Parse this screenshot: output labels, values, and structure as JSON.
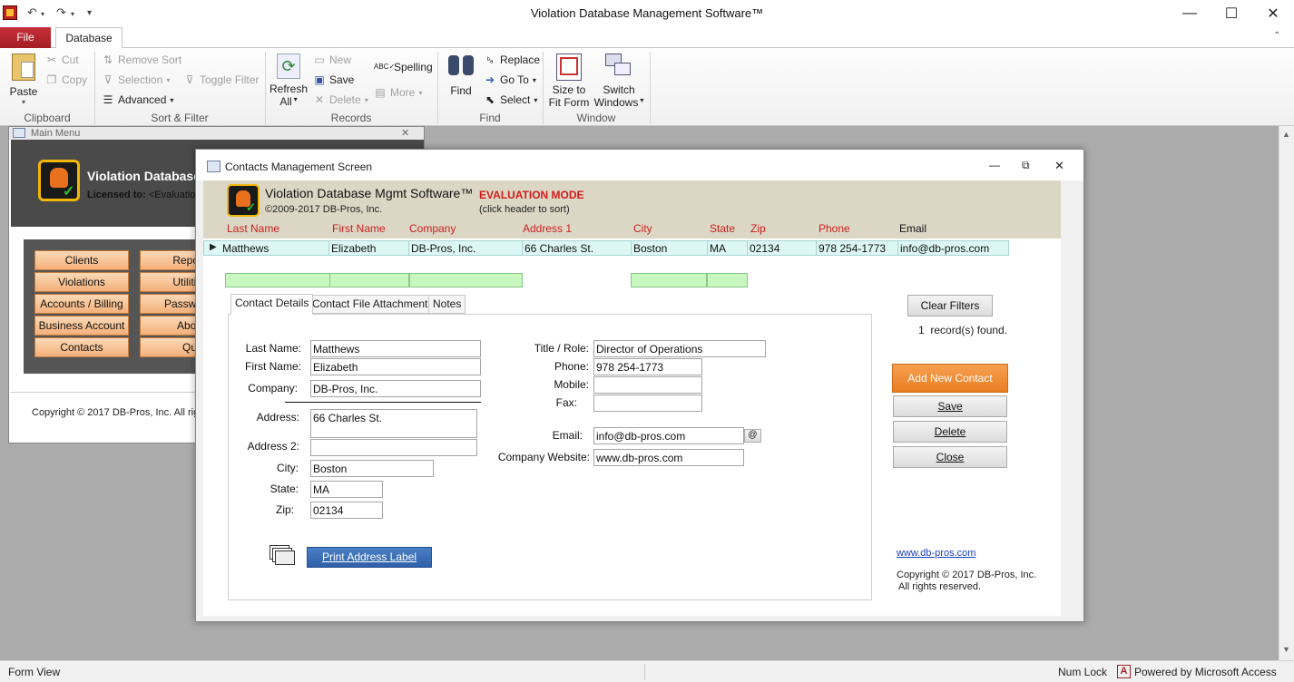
{
  "app": {
    "title": "Violation Database Management Software™"
  },
  "tabs": {
    "file": "File",
    "database": "Database"
  },
  "ribbon": {
    "clipboard": {
      "paste": "Paste",
      "cut": "Cut",
      "copy": "Copy",
      "label": "Clipboard"
    },
    "sort_filter": {
      "remove_sort": "Remove Sort",
      "selection": "Selection",
      "advanced": "Advanced",
      "toggle_filter": "Toggle Filter",
      "label": "Sort & Filter"
    },
    "records": {
      "refresh1": "Refresh",
      "refresh2": "All",
      "new": "New",
      "save": "Save",
      "delete": "Delete",
      "spelling": "Spelling",
      "more": "More",
      "label": "Records"
    },
    "find": {
      "find": "Find",
      "replace": "Replace",
      "goto": "Go To",
      "select": "Select",
      "label": "Find"
    },
    "window": {
      "size1": "Size to",
      "size2": "Fit Form",
      "switch1": "Switch",
      "switch2": "Windows",
      "label": "Window"
    }
  },
  "main_menu": {
    "title": "Main Menu",
    "app_name": "Violation Database",
    "licensed_label": "Licensed to:",
    "licensed_value": "<Evaluatio",
    "buttons_left": [
      "Clients",
      "Violations",
      "Accounts / Billing",
      "Business Account",
      "Contacts"
    ],
    "buttons_right": [
      "Repor",
      "Utilitie",
      "Passwo",
      "Abou",
      "Quit"
    ],
    "copyright": "Copyright © 2017 DB-Pros, Inc.  All righ"
  },
  "contacts": {
    "window_title": "Contacts Management Screen",
    "header_title": "Violation Database Mgmt Software™",
    "eval_mode": "EVALUATION MODE",
    "copyright": "©2009-2017 DB-Pros, Inc.",
    "sort_hint": "(click header to sort)",
    "columns": [
      "Last Name",
      "First Name",
      "Company",
      "Address 1",
      "City",
      "State",
      "Zip",
      "Phone",
      "Email"
    ],
    "row": [
      "Matthews",
      "Elizabeth",
      "DB-Pros, Inc.",
      "66 Charles St.",
      "Boston",
      "MA",
      "02134",
      "978 254-1773",
      "info@db-pros.com"
    ],
    "subtabs": [
      "Contact Details",
      "Contact File Attachments",
      "Notes"
    ],
    "labels": {
      "last_name": "Last Name:",
      "first_name": "First Name:",
      "company": "Company:",
      "address": "Address:",
      "address2": "Address 2:",
      "city": "City:",
      "state": "State:",
      "zip": "Zip:",
      "title_role": "Title / Role:",
      "phone": "Phone:",
      "mobile": "Mobile:",
      "fax": "Fax:",
      "email": "Email:",
      "website": "Company Website:"
    },
    "values": {
      "last_name": "Matthews",
      "first_name": "Elizabeth",
      "company": "DB-Pros, Inc.",
      "address": "66 Charles St.",
      "address2": "",
      "city": "Boston",
      "state": "MA",
      "zip": "02134",
      "title_role": "Director of Operations",
      "phone": "978 254-1773",
      "mobile": "",
      "fax": "",
      "email": "info@db-pros.com",
      "website": "www.db-pros.com"
    },
    "email_btn": "@",
    "print_label": "Print Address Label",
    "clear_filters": "Clear Filters",
    "record_count": "1",
    "records_found": "record(s) found.",
    "add_new": "Add New Contact",
    "save": "Save",
    "delete": "Delete",
    "close": "Close",
    "website_link": "www.db-pros.com",
    "footer1": "Copyright © 2017 DB-Pros, Inc.",
    "footer2": "All rights reserved."
  },
  "status": {
    "view": "Form View",
    "numlock": "Num Lock",
    "powered": "Powered by Microsoft Access"
  },
  "colors": {
    "accent_red": "#b7232a",
    "orange_button": "#f08a32",
    "header_band": "#dcd7c4",
    "filter_green": "#c8f7c0"
  }
}
